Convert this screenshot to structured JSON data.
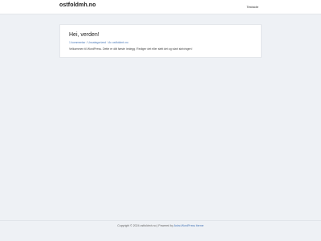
{
  "header": {
    "site_title": "ostfoldmh.no",
    "nav_item": "Testside"
  },
  "post": {
    "title": "Hei, verden!",
    "meta": {
      "comments": "1 kommentar",
      "category": "Uncategorized",
      "author": "Av ostfoldmh.no"
    },
    "excerpt": "Velkommen til WordPress. Dette er ditt første innlegg. Rediger det eller slett det og start skrivingen!"
  },
  "footer": {
    "copyright": "Copyright © 2024 ostfoldmh.no | Powered by",
    "theme_link": "Astra WordPress theme"
  }
}
